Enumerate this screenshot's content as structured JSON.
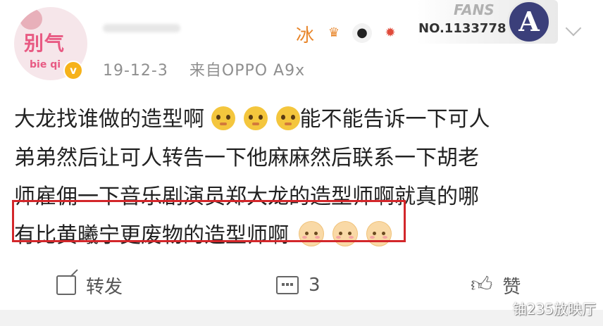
{
  "header": {
    "avatar_text": "别气",
    "avatar_subtext": "bie qi",
    "verified_badge": "v",
    "highlight_name": "冰",
    "badge_icons": [
      "crown-icon",
      "panda-icon",
      "flame-icon"
    ],
    "fans_label": "FANS",
    "fans_number": "NO.1133778",
    "avengers_glyph": "A"
  },
  "meta": {
    "date": "19-12-3",
    "source": "来自OPPO A9x"
  },
  "post": {
    "lines": [
      {
        "text": "大龙找谁做的造型啊",
        "emojis_after": [
          "pout-emoji",
          "pout-emoji",
          "pout-emoji"
        ],
        "trailing": "能不能告诉一下可人"
      },
      {
        "text": "弟弟然后让可人转告一下他麻麻然后联系一下胡老"
      },
      {
        "text": "师雇佣一下音乐剧演员郑大龙的造型师啊就真的哪"
      },
      {
        "text": "有比黄曦宁更废物的造型师啊",
        "emojis_after": [
          "shy-emoji",
          "shy-emoji",
          "shy-emoji"
        ]
      }
    ]
  },
  "actions": {
    "repost_label": "转发",
    "comment_count": "3",
    "like_label": "赞"
  },
  "watermark": "铀235放映厅",
  "colors": {
    "highlight_box": "#d3272b",
    "name_orange": "#e8862b",
    "meta_gray": "#8f8f8f"
  }
}
